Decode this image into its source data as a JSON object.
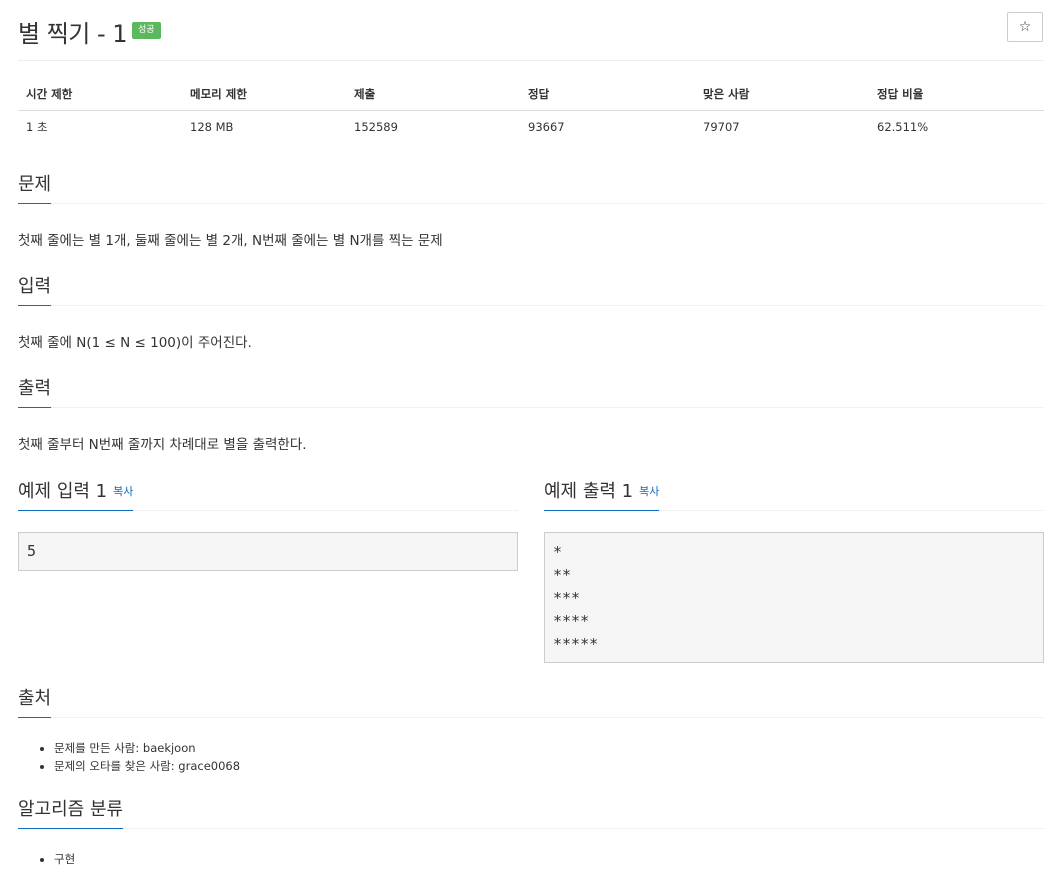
{
  "problem": {
    "title": "별 찍기 - 1",
    "badge": "성공",
    "star_icon": "☆"
  },
  "info_table": {
    "headers": [
      "시간 제한",
      "메모리 제한",
      "제출",
      "정답",
      "맞은 사람",
      "정답 비율"
    ],
    "values": [
      "1 초",
      "128 MB",
      "152589",
      "93667",
      "79707",
      "62.511%"
    ]
  },
  "sections": {
    "description": {
      "heading": "문제",
      "text": "첫째 줄에는 별 1개, 둘째 줄에는 별 2개, N번째 줄에는 별 N개를 찍는 문제"
    },
    "input": {
      "heading": "입력",
      "text": "첫째 줄에 N(1 ≤ N ≤ 100)이 주어진다."
    },
    "output": {
      "heading": "출력",
      "text": "첫째 줄부터 N번째 줄까지 차례대로 별을 출력한다."
    },
    "sample_input": {
      "heading": "예제 입력 1",
      "copy_label": "복사",
      "lines": [
        "5"
      ]
    },
    "sample_output": {
      "heading": "예제 출력 1",
      "copy_label": "복사",
      "lines": [
        "*",
        "**",
        "***",
        "****",
        "*****"
      ]
    },
    "source": {
      "heading": "출처",
      "items": [
        "문제를 만든 사람: baekjoon",
        "문제의 오타를 찾은 사람: grace0068"
      ]
    },
    "algorithm": {
      "heading": "알고리즘 분류",
      "items": [
        "구현"
      ]
    }
  },
  "colors": {
    "accent": "#0e6bbf",
    "success_badge": "#5cb85c"
  }
}
